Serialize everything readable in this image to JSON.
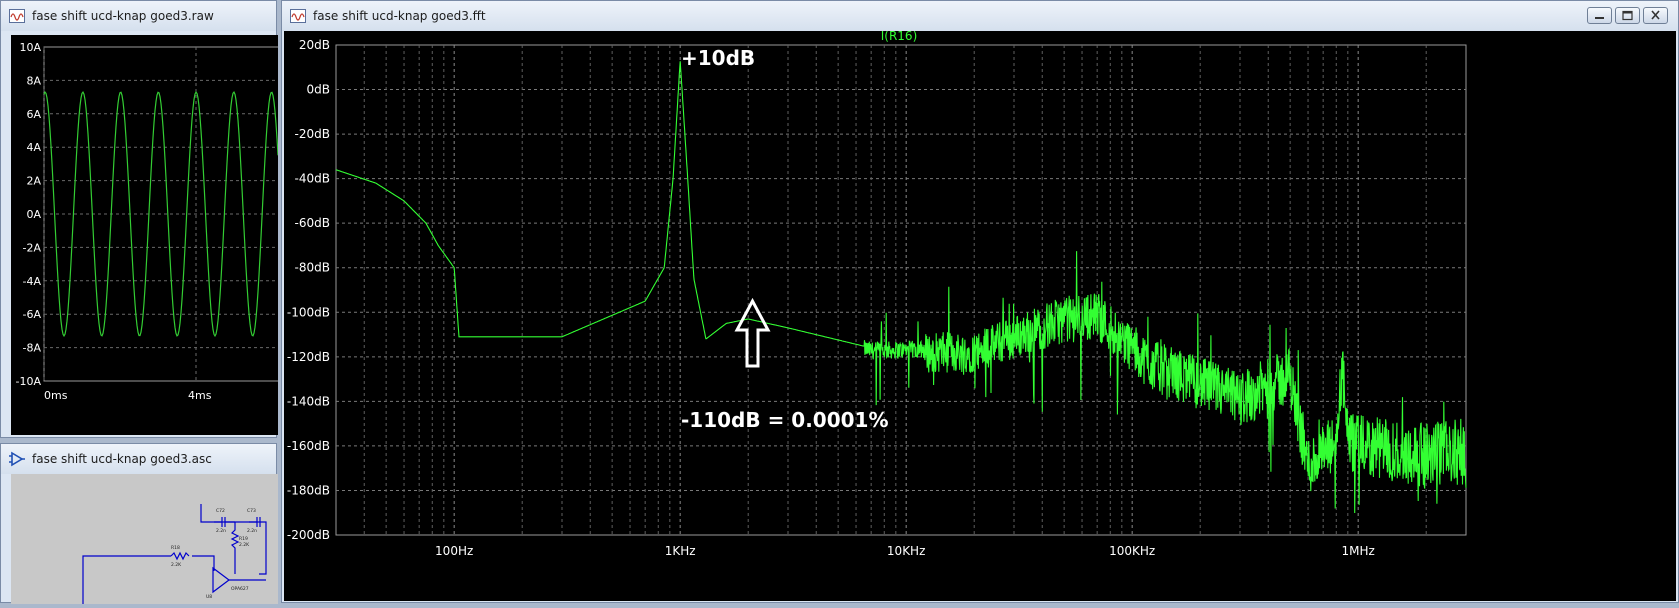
{
  "raw_window": {
    "title": "fase shift ucd-knap goed3.raw",
    "y_ticks": [
      "10A",
      "8A",
      "6A",
      "4A",
      "2A",
      "0A",
      "-2A",
      "-4A",
      "-6A",
      "-8A",
      "-10A"
    ],
    "x_ticks": [
      "0ms",
      "4ms"
    ]
  },
  "asc_window": {
    "title": "fase shift ucd-knap goed3.asc",
    "labels": [
      "R18",
      "2.2K",
      "C72",
      "2.2n",
      "C73",
      "2.2n",
      "R19",
      "2.2K",
      "OPA627",
      "U8"
    ]
  },
  "fft_window": {
    "title": "fase shift ucd-knap goed3.fft",
    "trace_name": "I(R16)",
    "annotation_peak": "+10dB",
    "annotation_floor": "-110dB = 0.0001%"
  },
  "chart_data": {
    "type": "line",
    "title": "I(R16)",
    "x_scale": "log",
    "xlim": [
      30,
      3000000
    ],
    "ylim": [
      -200,
      20
    ],
    "y_ticks": [
      "20dB",
      "0dB",
      "-20dB",
      "-40dB",
      "-60dB",
      "-80dB",
      "-100dB",
      "-120dB",
      "-140dB",
      "-160dB",
      "-180dB",
      "-200dB"
    ],
    "x_ticks": [
      "100Hz",
      "1KHz",
      "10KHz",
      "100KHz",
      "1MHz"
    ],
    "series": [
      {
        "color": "#33ff33",
        "x": [
          30,
          45,
          60,
          75,
          85,
          100,
          105,
          300,
          700,
          850,
          930,
          1000,
          1080,
          1150,
          1300,
          1600,
          2000,
          3000,
          7000,
          20000,
          50000,
          70000,
          120000,
          300000,
          500000,
          600000,
          800000,
          850000,
          900000,
          2000000,
          3000000
        ],
        "y": [
          -36,
          -42,
          -50,
          -60,
          -70,
          -80,
          -111,
          -111,
          -95,
          -80,
          -40,
          13,
          -40,
          -85,
          -112,
          -105,
          -103,
          -107,
          -116,
          -115,
          -100,
          -98,
          -120,
          -135,
          -125,
          -165,
          -155,
          -120,
          -155,
          -160,
          -158
        ]
      }
    ],
    "raw_trace": {
      "type": "sine",
      "y_unit": "A",
      "ylim": [
        -10,
        10
      ],
      "amplitude": 7.3,
      "cycles_visible": 6
    }
  }
}
